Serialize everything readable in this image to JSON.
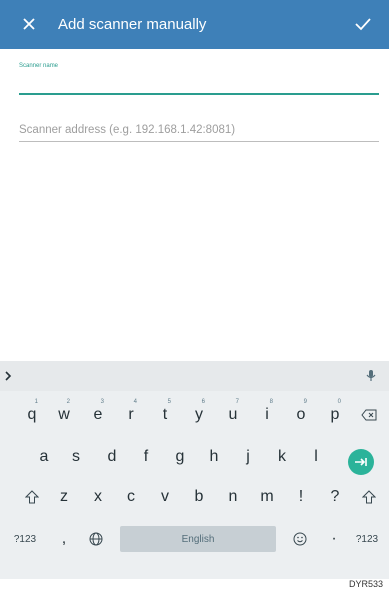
{
  "appbar": {
    "title": "Add scanner manually",
    "close_icon": "close-icon",
    "confirm_icon": "check-icon",
    "background": "#3e80b8"
  },
  "form": {
    "name_label": "Scanner name",
    "name_value": "",
    "address_placeholder": "Scanner address (e.g. 192.168.1.42:8081)",
    "accent": "#2a9d8f"
  },
  "keyboard": {
    "row1": [
      {
        "key": "q",
        "num": "1"
      },
      {
        "key": "w",
        "num": "2"
      },
      {
        "key": "e",
        "num": "3"
      },
      {
        "key": "r",
        "num": "4"
      },
      {
        "key": "t",
        "num": "5"
      },
      {
        "key": "y",
        "num": "6"
      },
      {
        "key": "u",
        "num": "7"
      },
      {
        "key": "i",
        "num": "8"
      },
      {
        "key": "o",
        "num": "9"
      },
      {
        "key": "p",
        "num": "0"
      }
    ],
    "row2": [
      "a",
      "s",
      "d",
      "f",
      "g",
      "h",
      "j",
      "k",
      "l"
    ],
    "row3": [
      "z",
      "x",
      "c",
      "v",
      "b",
      "n",
      "m",
      "!",
      "?"
    ],
    "row4": {
      "symbols_label": "?123",
      "comma": ",",
      "space_label": "English",
      "period": "·",
      "symbols_label_right": "?123"
    },
    "icons": {
      "expand": "chevron-right-icon",
      "mic": "mic-icon",
      "backspace": "backspace-icon",
      "enter": "next-arrow-icon",
      "shift": "shift-icon",
      "globe": "globe-icon",
      "emoji": "emoji-icon"
    }
  },
  "footer": {
    "code": "DYR533"
  }
}
